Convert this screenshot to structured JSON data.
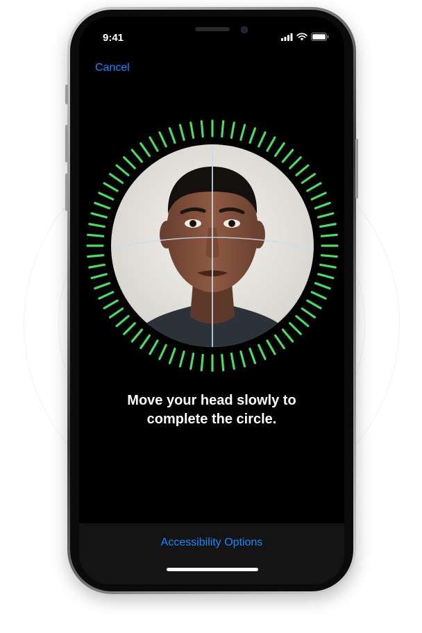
{
  "status_bar": {
    "time": "9:41",
    "icons": [
      "signal-icon",
      "wifi-icon",
      "battery-icon"
    ]
  },
  "nav": {
    "cancel_label": "Cancel"
  },
  "scan": {
    "progress": 1.0,
    "ring_color": "#4cd964",
    "instruction_line1": "Move your head slowly to",
    "instruction_line2": "complete the circle."
  },
  "footer": {
    "accessibility_label": "Accessibility Options"
  },
  "colors": {
    "accent": "#1a87ff",
    "screen_bg": "#000000"
  }
}
